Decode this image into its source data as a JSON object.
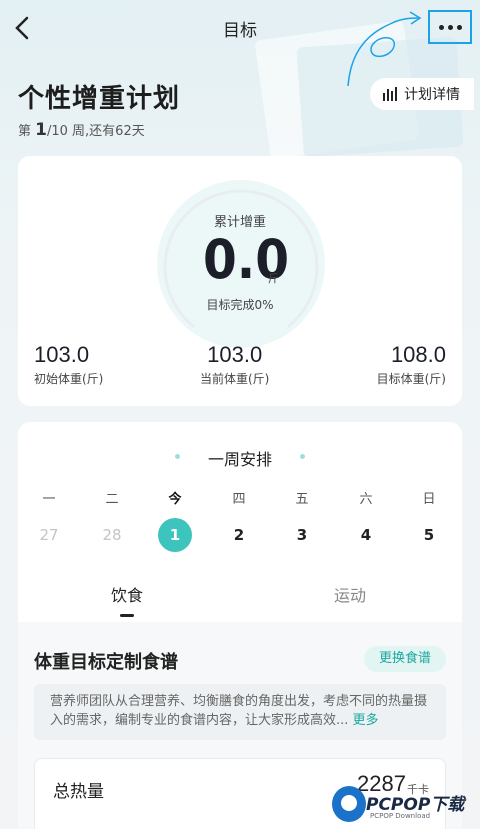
{
  "nav": {
    "title": "目标"
  },
  "plan": {
    "title": "个性增重计划",
    "week_prefix": "第 ",
    "week_current": "1",
    "week_rest": "/10 周,还有62天",
    "detail_button": "计划详情"
  },
  "progress": {
    "label": "累计增重",
    "value": "0.0",
    "unit": "斤",
    "completion": "目标完成0%",
    "completion_fraction": 0.0
  },
  "stats": [
    {
      "value": "103.0",
      "label": "初始体重(斤)"
    },
    {
      "value": "103.0",
      "label": "当前体重(斤)"
    },
    {
      "value": "108.0",
      "label": "目标体重(斤)"
    }
  ],
  "week": {
    "title": "一周安排",
    "days": [
      "一",
      "二",
      "今",
      "四",
      "五",
      "六",
      "日"
    ],
    "dates": [
      "27",
      "28",
      "1",
      "2",
      "3",
      "4",
      "5"
    ],
    "selected_index": 2
  },
  "tabs": [
    "饮食",
    "运动"
  ],
  "diet": {
    "title": "体重目标定制食谱",
    "change_button": "更换食谱",
    "description": "营养师团队从合理营养、均衡膳食的角度出发，考虑不同的热量摄入的需求，编制专业的食谱内容，让大家形成高效...",
    "more": "更多",
    "calorie_label": "总热量",
    "calorie_value": "2287",
    "calorie_unit": "千卡"
  },
  "watermark": {
    "text": "PCPOP下载",
    "sub": "PCPOP Download"
  },
  "colors": {
    "accent": "#3dc4bc",
    "annotation": "#1aa3e8"
  }
}
